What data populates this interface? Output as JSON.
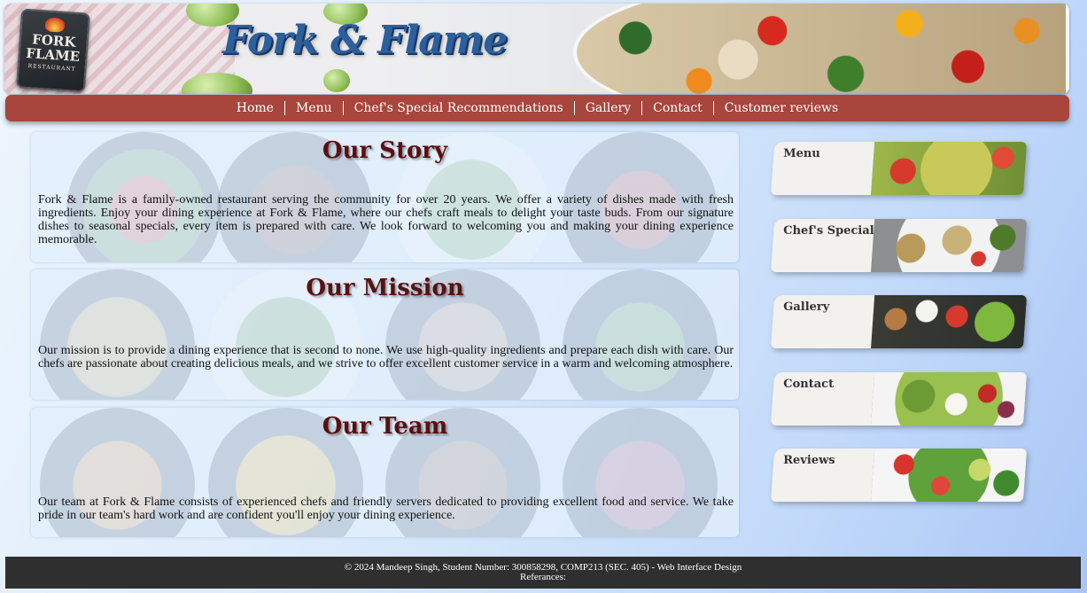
{
  "brand": {
    "title": "Fork & Flame",
    "logo_line1": "FORK",
    "logo_line2": "FLAME",
    "logo_sub": "RESTAURANT"
  },
  "nav": {
    "items": [
      {
        "label": "Home"
      },
      {
        "label": "Menu"
      },
      {
        "label": "Chef's Special Recommendations"
      },
      {
        "label": "Gallery"
      },
      {
        "label": "Contact"
      },
      {
        "label": "Customer reviews"
      }
    ]
  },
  "sections": [
    {
      "heading": "Our Story",
      "body": "Fork & Flame is a family-owned restaurant serving the community for over 20 years. We offer a variety of dishes made with fresh ingredients. Enjoy your dining experience at Fork & Flame, where our chefs craft meals to delight your taste buds. From our signature dishes to seasonal specials, every item is prepared with care. We look forward to welcoming you and making your dining experience memorable."
    },
    {
      "heading": "Our Mission",
      "body": "Our mission is to provide a dining experience that is second to none. We use high-quality ingredients and prepare each dish with care. Our chefs are passionate about creating delicious meals, and we strive to offer excellent customer service in a warm and welcoming atmosphere."
    },
    {
      "heading": "Our Team",
      "body": "Our team at Fork & Flame consists of experienced chefs and friendly servers dedicated to providing excellent food and service. We take pride in our team's hard work and are confident you'll enjoy your dining experience."
    }
  ],
  "side_links": [
    {
      "label": "Menu"
    },
    {
      "label": "Chef's Special"
    },
    {
      "label": "Gallery"
    },
    {
      "label": "Contact"
    },
    {
      "label": "Reviews"
    }
  ],
  "footer": {
    "copyright": "© 2024 Mandeep Singh, Student Number: 300858298, COMP213 (SEC. 405) - Web Interface Design",
    "references": "Referances:"
  },
  "colors": {
    "nav_bg": "#a8453c",
    "heading": "#5a1010",
    "brand_title": "#2c5f9c",
    "footer_bg": "#2f2f2f",
    "side_label_bg": "#f3f1ee"
  }
}
